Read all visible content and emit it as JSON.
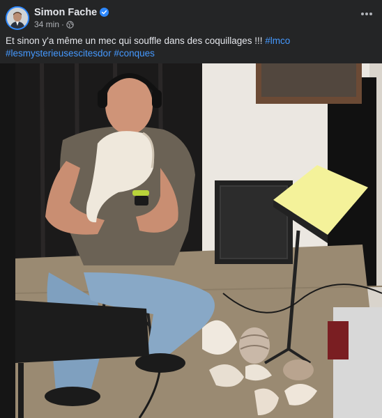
{
  "post": {
    "author": "Simon Fache",
    "time": "34 min",
    "separator": "·",
    "caption_text": "Et sinon y'a même un mec qui souffle dans des coquillages !!! ",
    "hashtags": [
      "#lmco",
      "#lesmysterieusescitesdor",
      "#conques"
    ],
    "icons": {
      "verified": "verified-badge-icon",
      "audience": "globe-icon",
      "more": "more-options-icon"
    },
    "colors": {
      "link": "#4599ff",
      "verified": "#2d88ff",
      "background": "#242526",
      "text": "#e4e6eb",
      "secondary_text": "#b0b3b8"
    }
  }
}
